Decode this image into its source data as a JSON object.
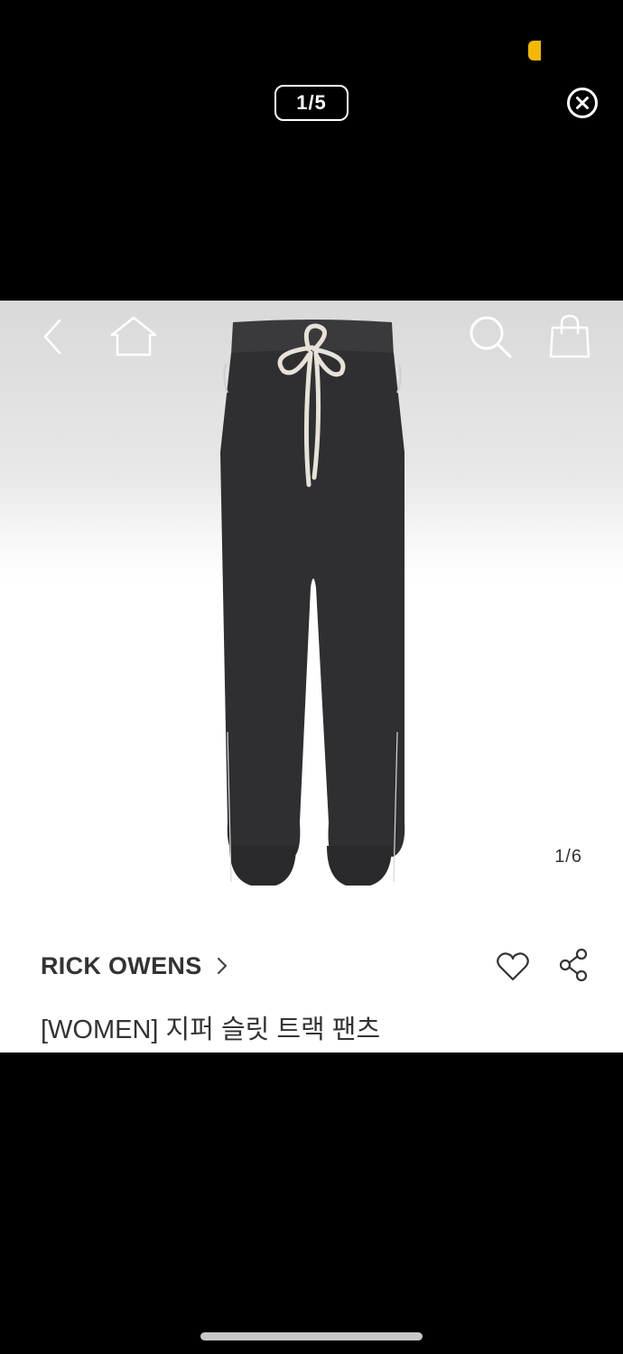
{
  "viewer": {
    "page_counter": "1/5"
  },
  "product": {
    "image_counter": "1/6",
    "brand": "RICK OWENS",
    "name": "[WOMEN] 지퍼 슬릿 트랙 팬츠"
  },
  "icons": {
    "close": "close-circle-icon",
    "back": "chevron-left-icon",
    "home": "home-icon",
    "search": "search-icon",
    "bag": "shopping-bag-icon",
    "brand_chevron": "chevron-right-icon",
    "wishlist": "heart-icon",
    "share": "share-icon"
  },
  "colors": {
    "background": "#000000",
    "status_accent": "#f5b800",
    "text": "#333333"
  }
}
